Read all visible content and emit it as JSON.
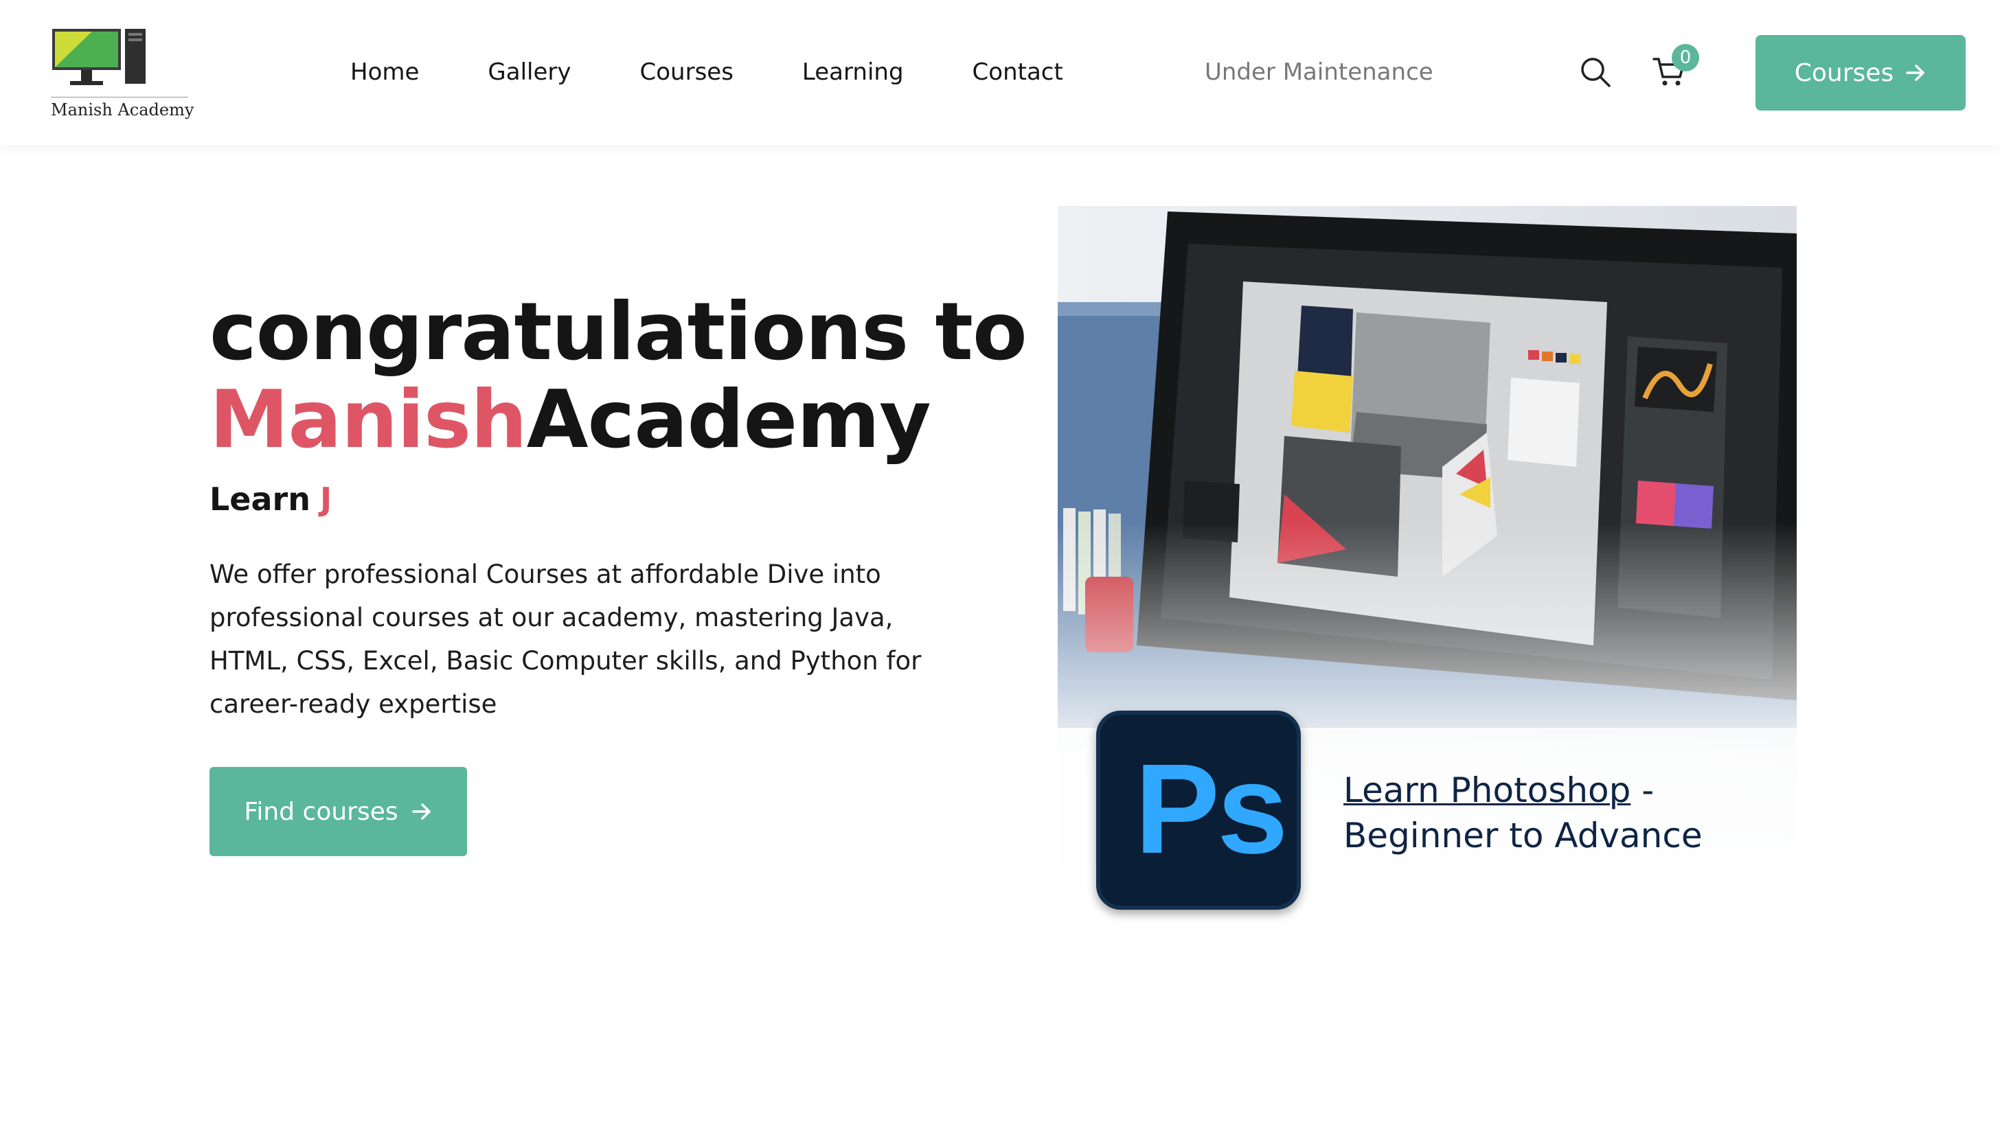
{
  "brand": {
    "name": "Manish Academy"
  },
  "nav": {
    "items": [
      "Home",
      "Gallery",
      "Courses",
      "Learning",
      "Contact"
    ],
    "notice": "Under Maintenance",
    "cart_count": "0",
    "cta_label": "Courses",
    "icons": [
      "search-icon",
      "cart-icon",
      "arrow-right-icon"
    ]
  },
  "hero": {
    "title_line1": "congratulations to",
    "title_accent": "Manish",
    "title_rest": "Academy",
    "subtitle_prefix": "Learn",
    "subtitle_typed": "J",
    "description": "We offer professional Courses at affordable Dive into professional courses at our academy, mastering Java, HTML, CSS, Excel, Basic Computer skills, and Python for career-ready expertise",
    "button_label": "Find courses"
  },
  "card": {
    "logo_text": "Ps",
    "caption_link": "Learn Photoshop",
    "caption_rest": " - Beginner to Advance"
  },
  "colors": {
    "accent_green": "#5ab79a",
    "accent_red": "#de5665",
    "text_dark": "#151515",
    "photoshop_bg": "#0a1e36",
    "photoshop_text": "#31a8ff"
  }
}
